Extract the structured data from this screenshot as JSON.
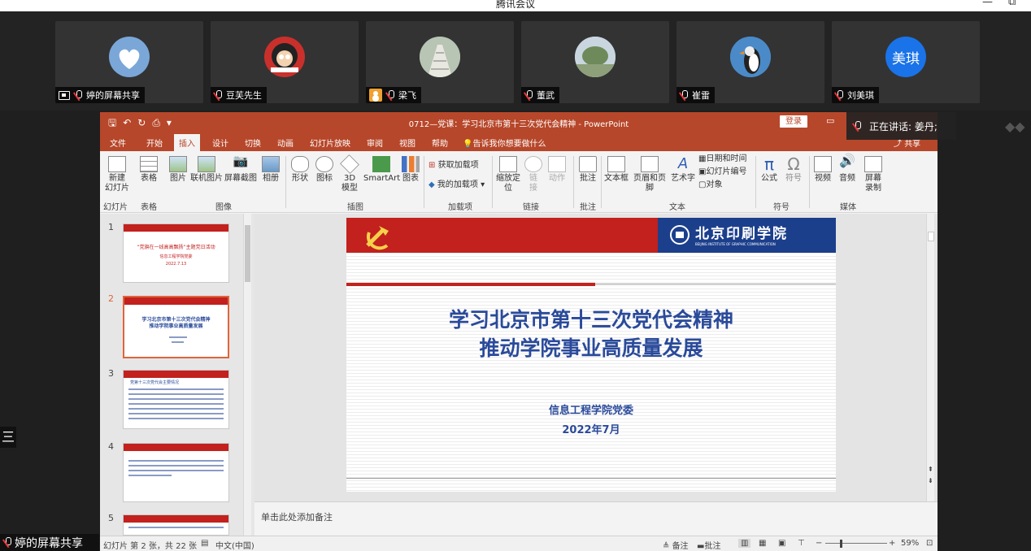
{
  "meeting": {
    "app_title": "腾讯会议",
    "participants": [
      {
        "name": "婷的屏幕共享",
        "avatar": "heart-cloud"
      },
      {
        "name": "豆芙先生",
        "avatar": "astro-boy"
      },
      {
        "name": "梁飞",
        "avatar": "bridge"
      },
      {
        "name": "董武",
        "avatar": "tree"
      },
      {
        "name": "崔雷",
        "avatar": "puffin"
      },
      {
        "name": "刘美琪",
        "avatar": "initials",
        "initials": "美琪",
        "color": "#1a73e8"
      }
    ],
    "speaking_label": "正在讲话: 姜丹;",
    "share_label": "婷的屏幕共享",
    "side_tab": "三"
  },
  "ppt": {
    "doc_title": "0712—党课：学习北京市第十三次党代会精神  -  PowerPoint",
    "login": "登录",
    "share": "共享",
    "tabs": [
      "文件",
      "开始",
      "插入",
      "设计",
      "切换",
      "动画",
      "幻灯片放映",
      "审阅",
      "视图",
      "帮助"
    ],
    "tell_me": "告诉我你想要做什么",
    "ribbon": {
      "new_slide": "新建\n幻灯片",
      "table": "表格",
      "picture": "图片",
      "online_picture": "联机图片",
      "screenshot": "屏幕截图",
      "album": "相册",
      "shapes": "形状",
      "icons": "图标",
      "model3d": "3D\n模型",
      "smartart": "SmartArt",
      "chart": "图表",
      "get_addins": "获取加载项",
      "my_addins": "我的加载项",
      "zoom": "缩放定\n位",
      "link": "链\n接",
      "action": "动作",
      "comment": "批注",
      "textbox": "文本框",
      "header_footer": "页眉和页脚",
      "wordart": "艺术字",
      "datetime": "日期和时间",
      "slide_number": "幻灯片编号",
      "object": "对象",
      "equation": "公式",
      "symbol": "符号",
      "video": "视频",
      "audio": "音频",
      "screen_record": "屏幕\n录制",
      "groups": [
        "幻灯片",
        "表格",
        "图像",
        "插图",
        "加载项",
        "链接",
        "批注",
        "文本",
        "符号",
        "媒体"
      ]
    },
    "slide": {
      "logo_text": "北京印刷学院",
      "logo_en": "BEIJING INSTITUTE OF GRAPHIC COMMUNICATION",
      "title_line1": "学习北京市第十三次党代会精神",
      "title_line2": "推动学院事业高质量发展",
      "org": "信息工程学院党委",
      "date": "2022年7月"
    },
    "thumbs": [
      {
        "num": "1",
        "title": "“党旗在一线高高飘扬”主题党日活动",
        "sub1": "信息工程学院党委",
        "sub2": "2022.7.13"
      },
      {
        "num": "2",
        "title": "学习北京市第十三次党代会精神",
        "sub1": "推动学院事业高质量发展"
      },
      {
        "num": "3",
        "title": "党第十三次党代会主要情况"
      },
      {
        "num": "4",
        "title": ""
      },
      {
        "num": "5",
        "title": ""
      }
    ],
    "notes_placeholder": "单击此处添加备注",
    "status": {
      "slide_info": "幻灯片 第 2 张，共 22 张",
      "language": "中文(中国)",
      "notes": "备注",
      "comments": "批注",
      "zoom": "59%"
    }
  }
}
